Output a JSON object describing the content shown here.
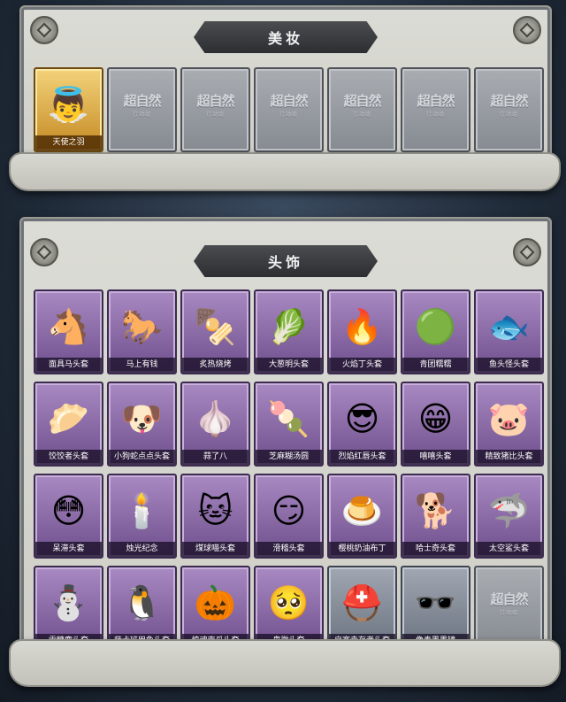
{
  "makeup": {
    "title": "美妆",
    "items": [
      {
        "label": "天使之羽",
        "icon": "angel-wing-icon",
        "glyph": "👼",
        "state": "owned-gold"
      },
      {
        "label": "",
        "icon": "locked-placeholder-icon",
        "state": "empty"
      },
      {
        "label": "",
        "icon": "locked-placeholder-icon",
        "state": "empty"
      },
      {
        "label": "",
        "icon": "locked-placeholder-icon",
        "state": "empty"
      },
      {
        "label": "",
        "icon": "locked-placeholder-icon",
        "state": "empty"
      },
      {
        "label": "",
        "icon": "locked-placeholder-icon",
        "state": "empty"
      },
      {
        "label": "",
        "icon": "locked-placeholder-icon",
        "state": "empty"
      }
    ]
  },
  "headwear": {
    "title": "头饰",
    "items": [
      {
        "label": "面具马头套",
        "icon": "horse-head-icon",
        "glyph": "🐴"
      },
      {
        "label": "马上有钱",
        "icon": "pink-horse-icon",
        "glyph": "🐎"
      },
      {
        "label": "炙热烧烤",
        "icon": "bbq-skewer-icon",
        "glyph": "🍢"
      },
      {
        "label": "大葱明头套",
        "icon": "scallion-icon",
        "glyph": "🥬"
      },
      {
        "label": "火焰丁头套",
        "icon": "fire-sprite-icon",
        "glyph": "🔥"
      },
      {
        "label": "青团糯糯",
        "icon": "green-dumpling-icon",
        "glyph": "🟢"
      },
      {
        "label": "鱼头怪头套",
        "icon": "fish-monster-icon",
        "glyph": "🐟"
      },
      {
        "label": "饺饺者头套",
        "icon": "dumpling-icon",
        "glyph": "🥟"
      },
      {
        "label": "小狗蛇点点头套",
        "icon": "dog-face-icon",
        "glyph": "🐶"
      },
      {
        "label": "蒜了八",
        "icon": "garlic-icon",
        "glyph": "🧄"
      },
      {
        "label": "芝麻糊汤圆",
        "icon": "rice-ball-icon",
        "glyph": "🍡"
      },
      {
        "label": "烈焰红唇头套",
        "icon": "pikachu-sunglasses-icon",
        "glyph": "😎"
      },
      {
        "label": "嘻嘻头套",
        "icon": "grin-face-icon",
        "glyph": "😁"
      },
      {
        "label": "精致猪比头套",
        "icon": "pink-pig-icon",
        "glyph": "🐷"
      },
      {
        "label": "呆滞头套",
        "icon": "stunned-face-icon",
        "glyph": "😳"
      },
      {
        "label": "烛光纪念",
        "icon": "candle-icon",
        "glyph": "🕯️"
      },
      {
        "label": "煤球喵头套",
        "icon": "black-cat-icon",
        "glyph": "🐱"
      },
      {
        "label": "滑稽头套",
        "icon": "smirk-face-icon",
        "glyph": "😏"
      },
      {
        "label": "樱桃奶油布丁",
        "icon": "pudding-icon",
        "glyph": "🍮"
      },
      {
        "label": "哈士奇头套",
        "icon": "husky-icon",
        "glyph": "🐕"
      },
      {
        "label": "太空鲨头套",
        "icon": "shark-icon",
        "glyph": "🦈"
      },
      {
        "label": "雪糖鹿头套",
        "icon": "snowman-deer-icon",
        "glyph": "⛄"
      },
      {
        "label": "萨卡班甲鱼头套",
        "icon": "penguin-fish-icon",
        "glyph": "🐧"
      },
      {
        "label": "惊魂南瓜头套",
        "icon": "pumpkin-icon",
        "glyph": "🎃"
      },
      {
        "label": "卑微头套",
        "icon": "humble-face-icon",
        "glyph": "🥺"
      },
      {
        "label": "启赛幸存者头套",
        "icon": "gas-mask-helmet-icon",
        "glyph": "⛑️",
        "state": "dark"
      },
      {
        "label": "像素黑墨镜",
        "icon": "pixel-sunglasses-icon",
        "glyph": "🕶️",
        "state": "dark"
      },
      {
        "label": "",
        "icon": "locked-placeholder-icon",
        "state": "empty"
      }
    ]
  },
  "placeholder": {
    "brand": "超自然",
    "sub": "行动组"
  }
}
